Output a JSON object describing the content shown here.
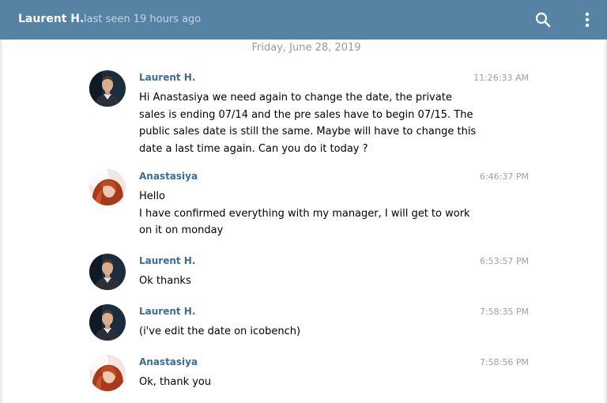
{
  "header": {
    "name": "Laurent H.",
    "status": "last seen 19 hours ago",
    "search_icon": "search-icon",
    "more_icon": "more-vertical-icon",
    "bg_color": "#5682a3"
  },
  "date_separator": "Friday, June 28, 2019",
  "messages": [
    {
      "author": "Laurent H.",
      "time": "11:26:33 AM",
      "avatar": "laurent",
      "lines": [
        "Hi Anastasiya we need again to change the date, the private",
        "sales is ending 07/14 and the pre sales have to begin 07/15. The",
        "public sales date is still the same. Maybe will have to change this",
        "date a last time again. Can you do it today ?"
      ]
    },
    {
      "author": "Anastasiya",
      "time": "6:46:37 PM",
      "avatar": "anastasiya",
      "lines": [
        "Hello",
        "I have confirmed everything with my manager, I will get to work",
        "on it on monday"
      ]
    },
    {
      "author": "Laurent H.",
      "time": "6:53:57 PM",
      "avatar": "laurent",
      "lines": [
        "Ok thanks"
      ]
    },
    {
      "author": "Laurent H.",
      "time": "7:58:35 PM",
      "avatar": "laurent",
      "lines": [
        "(i've edit the date on icobench)"
      ]
    },
    {
      "author": "Anastasiya",
      "time": "7:58:56 PM",
      "avatar": "anastasiya",
      "lines": [
        "Ok, thank you"
      ]
    }
  ]
}
